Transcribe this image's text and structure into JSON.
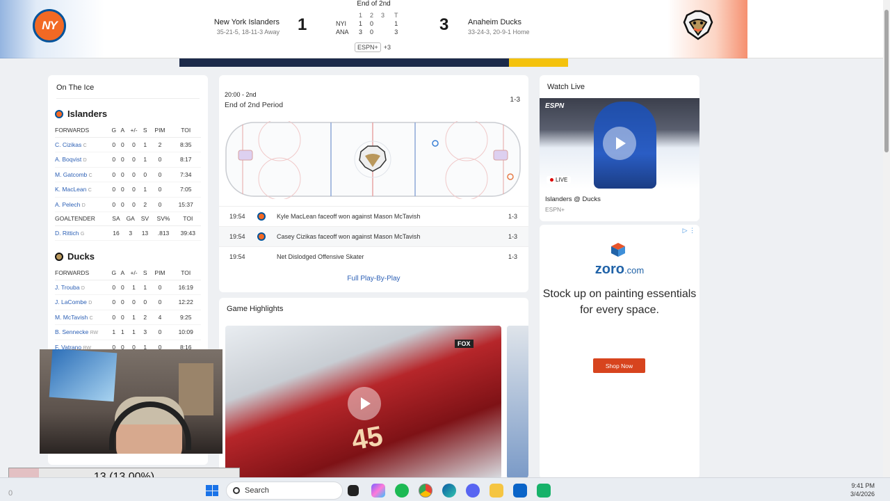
{
  "header": {
    "period_status": "End of 2nd",
    "home": {
      "name": "New York Islanders",
      "record": "35-21-5, 18-11-3 Away",
      "score": "1",
      "logo_text": "NY"
    },
    "away": {
      "name": "Anaheim Ducks",
      "record": "33-24-3, 20-9-1 Home",
      "score": "3"
    },
    "linescore": {
      "headers": [
        "",
        "1",
        "2",
        "3",
        "T"
      ],
      "rows": [
        {
          "team": "NYI",
          "p1": "1",
          "p2": "0",
          "p3": "",
          "t": "1"
        },
        {
          "team": "ANA",
          "p1": "3",
          "p2": "0",
          "p3": "",
          "t": "3"
        }
      ]
    },
    "network": "ESPN+",
    "network_more": "+3"
  },
  "on_ice": {
    "title": "On The Ice",
    "islanders": {
      "name": "Islanders",
      "forward_headers": [
        "FORWARDS",
        "G",
        "A",
        "+/-",
        "S",
        "PIM",
        "TOI"
      ],
      "forwards": [
        {
          "name": "C. Cizikas",
          "pos": "C",
          "g": "0",
          "a": "0",
          "pm": "0",
          "s": "1",
          "pim": "2",
          "toi": "8:35"
        },
        {
          "name": "A. Boqvist",
          "pos": "D",
          "g": "0",
          "a": "0",
          "pm": "0",
          "s": "1",
          "pim": "0",
          "toi": "8:17"
        },
        {
          "name": "M. Gatcomb",
          "pos": "C",
          "g": "0",
          "a": "0",
          "pm": "0",
          "s": "0",
          "pim": "0",
          "toi": "7:34"
        },
        {
          "name": "K. MacLean",
          "pos": "C",
          "g": "0",
          "a": "0",
          "pm": "0",
          "s": "1",
          "pim": "0",
          "toi": "7:05"
        },
        {
          "name": "A. Pelech",
          "pos": "D",
          "g": "0",
          "a": "0",
          "pm": "0",
          "s": "2",
          "pim": "0",
          "toi": "15:37"
        }
      ],
      "goalie_headers": [
        "GOALTENDER",
        "SA",
        "GA",
        "SV",
        "SV%",
        "TOI"
      ],
      "goalie": {
        "name": "D. Rittich",
        "pos": "G",
        "sa": "16",
        "ga": "3",
        "sv": "13",
        "svp": ".813",
        "toi": "39:43"
      }
    },
    "ducks": {
      "name": "Ducks",
      "forward_headers": [
        "FORWARDS",
        "G",
        "A",
        "+/-",
        "S",
        "PIM",
        "TOI"
      ],
      "forwards": [
        {
          "name": "J. Trouba",
          "pos": "D",
          "g": "0",
          "a": "0",
          "pm": "1",
          "s": "1",
          "pim": "0",
          "toi": "16:19"
        },
        {
          "name": "J. LaCombe",
          "pos": "D",
          "g": "0",
          "a": "0",
          "pm": "0",
          "s": "0",
          "pim": "0",
          "toi": "12:22"
        },
        {
          "name": "M. McTavish",
          "pos": "C",
          "g": "0",
          "a": "0",
          "pm": "1",
          "s": "2",
          "pim": "4",
          "toi": "9:25"
        },
        {
          "name": "B. Sennecke",
          "pos": "RW",
          "g": "1",
          "a": "1",
          "pm": "1",
          "s": "3",
          "pim": "0",
          "toi": "10:09"
        },
        {
          "name": "F. Vatrano",
          "pos": "RW",
          "g": "0",
          "a": "0",
          "pm": "0",
          "s": "1",
          "pim": "0",
          "toi": "8:16"
        }
      ]
    }
  },
  "pbp": {
    "clock": "20:00 - 2nd",
    "period": "End of 2nd Period",
    "score": "1-3",
    "plays": [
      {
        "time": "19:54",
        "desc": "Kyle MacLean faceoff won against Mason McTavish",
        "score": "1-3",
        "icon": "islanders-logo"
      },
      {
        "time": "19:54",
        "desc": "Casey Cizikas faceoff won against Mason McTavish",
        "score": "1-3",
        "icon": "islanders-logo"
      },
      {
        "time": "19:54",
        "desc": "Net Dislodged Offensive Skater",
        "score": "1-3",
        "icon": ""
      }
    ],
    "full_link": "Full Play-By-Play"
  },
  "highlights": {
    "title": "Game Highlights",
    "jersey": "45",
    "broadcaster": "FOX"
  },
  "watch_live": {
    "title": "Watch Live",
    "brand": "ESPN",
    "live_label": "LIVE",
    "game": "Islanders @ Ducks",
    "network": "ESPN+"
  },
  "ad": {
    "brand": "zoro",
    "brand_suffix": ".com",
    "copy": "Stock up on painting essentials for every space.",
    "cta": "Shop Now"
  },
  "counter": {
    "label": "13 (13.00%)",
    "fraction": 0.13
  },
  "taskbar": {
    "search_placeholder": "Search",
    "time": "9:41 PM",
    "date": "3/4/2026",
    "corner": "0"
  },
  "colors": {
    "nyi_orange": "#f26924",
    "nyi_blue": "#00539b",
    "link_blue": "#2b5fb5",
    "ad_orange": "#d7441e"
  }
}
